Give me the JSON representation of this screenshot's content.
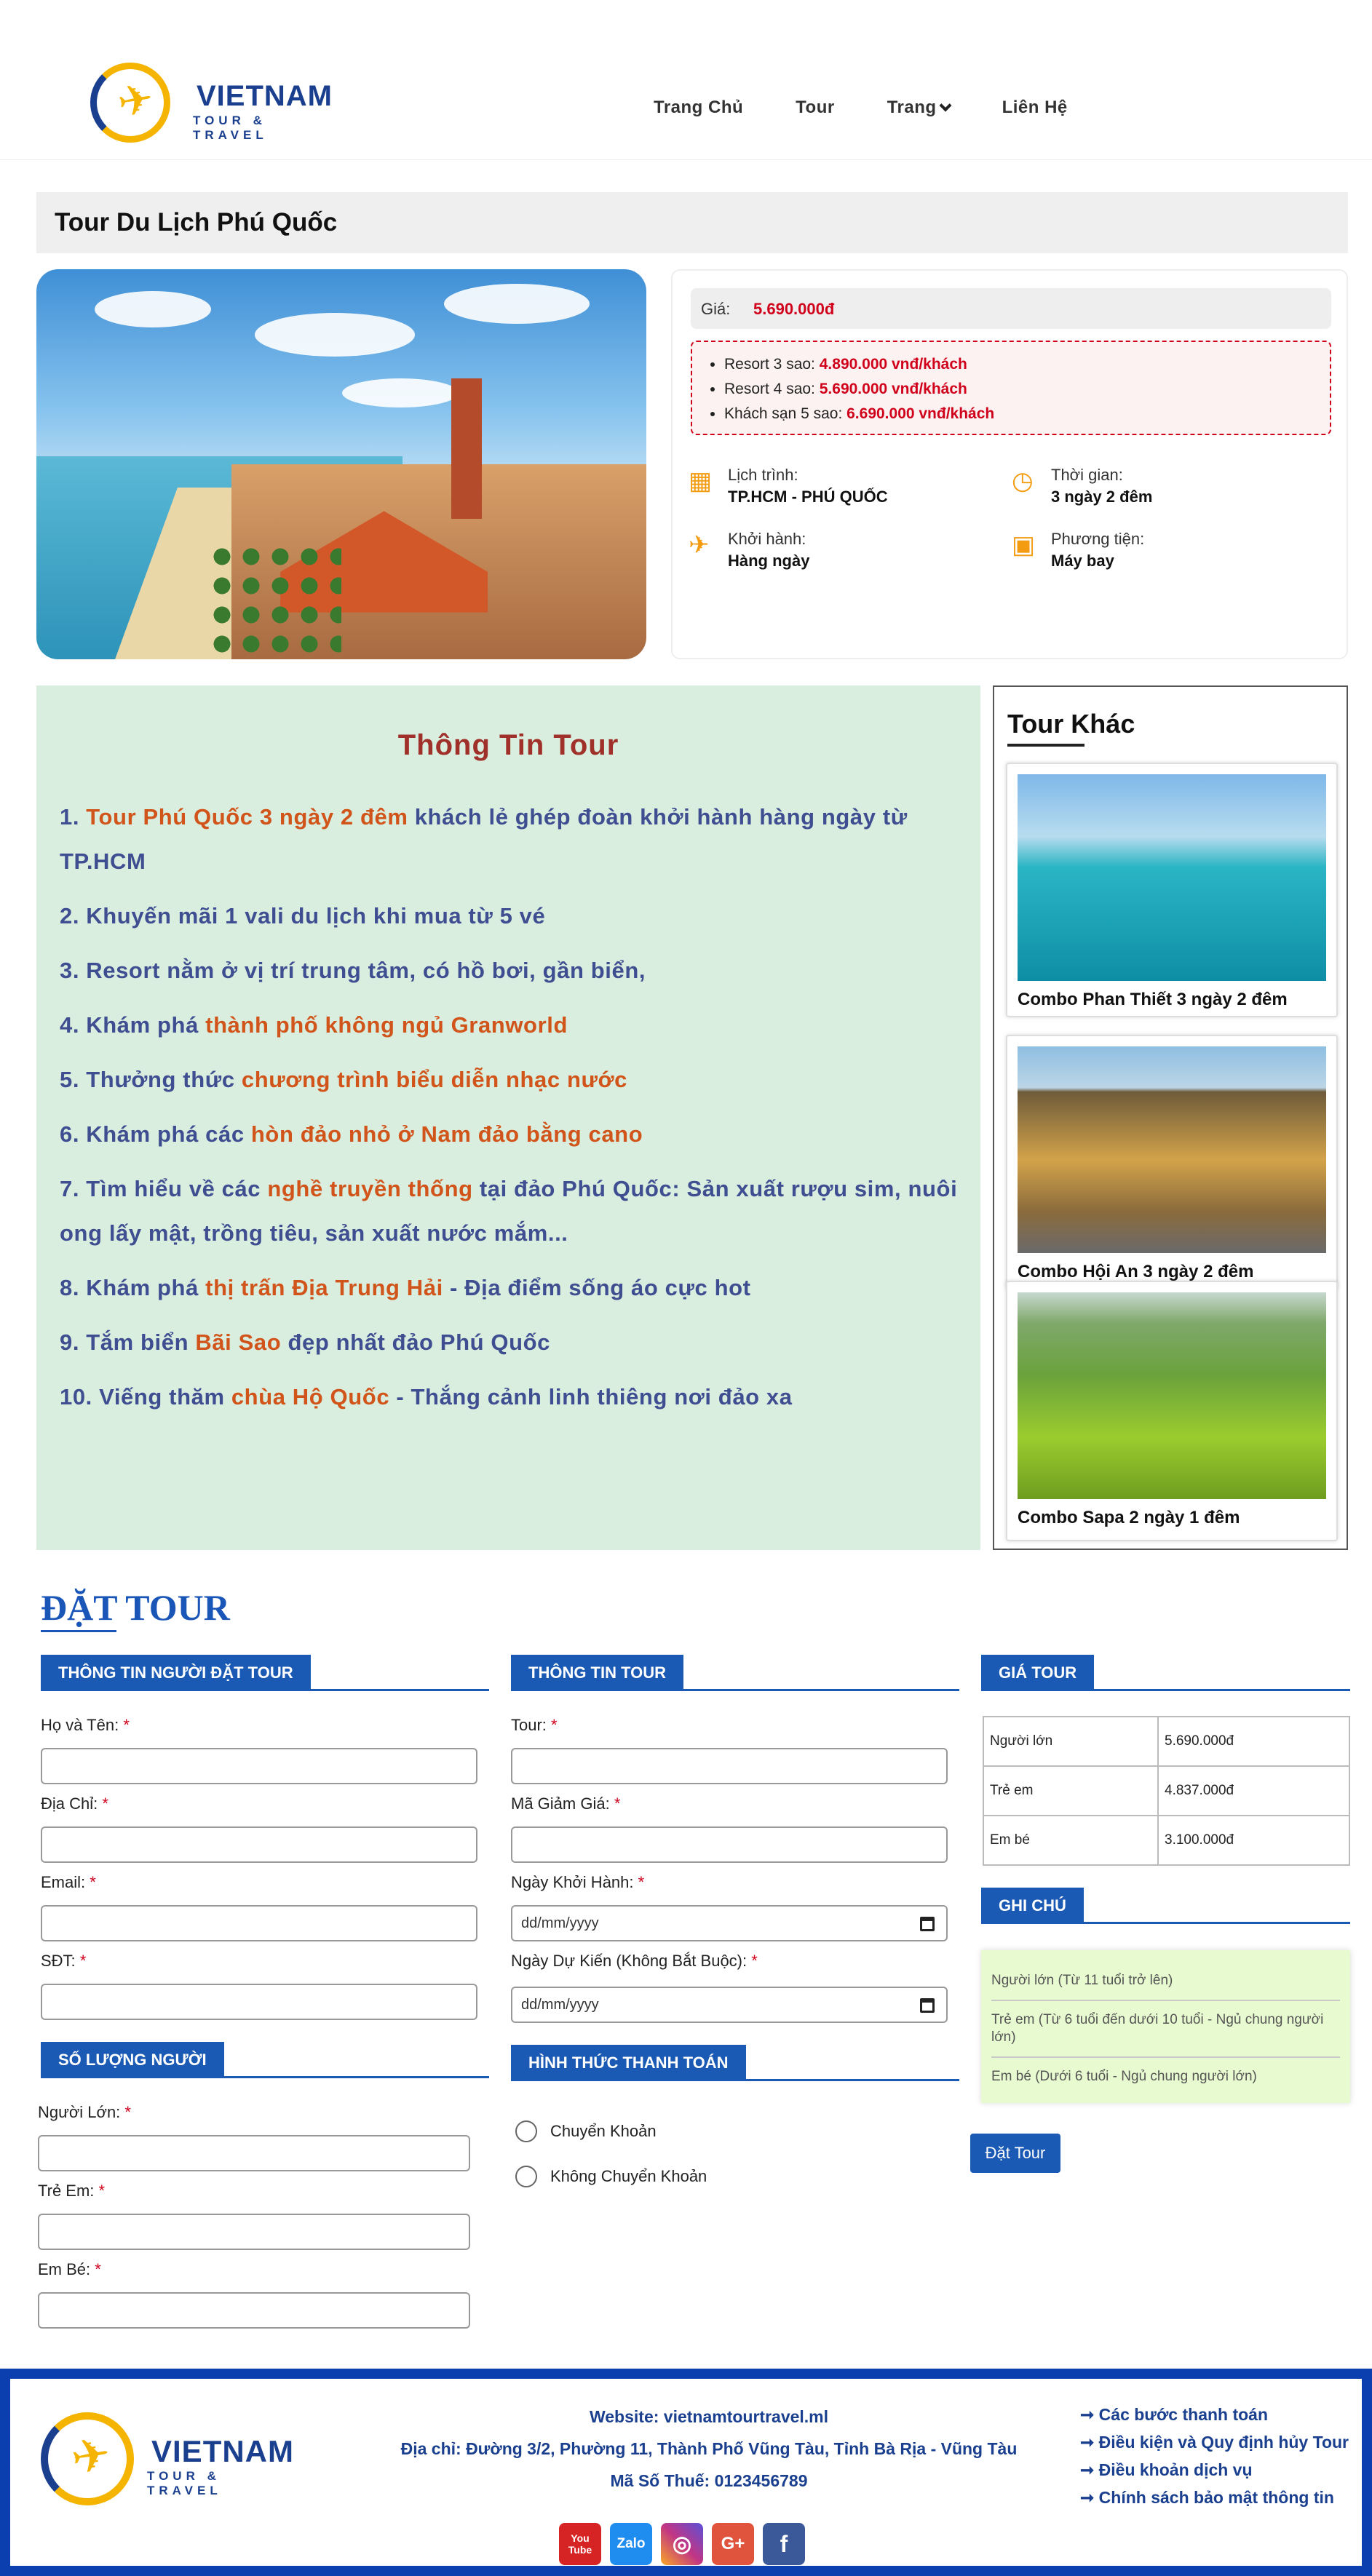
{
  "brand": {
    "name": "VIETNAM",
    "tagline": "TOUR & TRAVEL"
  },
  "nav": [
    {
      "label": "Trang Chủ"
    },
    {
      "label": "Tour"
    },
    {
      "label": "Trang"
    },
    {
      "label": "Liên Hệ"
    }
  ],
  "page_title": "Tour Du Lịch Phú Quốc",
  "price": {
    "label": "Giá:",
    "value": "5.690.000đ"
  },
  "options": [
    {
      "label": "Resort 3 sao:",
      "price": "4.890.000 vnđ/khách"
    },
    {
      "label": "Resort 4 sao:",
      "price": "5.690.000 vnđ/khách"
    },
    {
      "label": "Khách sạn 5 sao:",
      "price": "6.690.000 vnđ/khách"
    }
  ],
  "meta": {
    "schedule": {
      "label": "Lịch trình:",
      "value": "TP.HCM - PHÚ QUỐC",
      "icon": "calendar-icon"
    },
    "duration": {
      "label": "Thời gian:",
      "value": "3 ngày 2 đêm",
      "icon": "clock-icon"
    },
    "departure": {
      "label": "Khởi hành:",
      "value": "Hàng ngày",
      "icon": "plane-icon"
    },
    "transport": {
      "label": "Phương tiện:",
      "value": "Máy bay",
      "icon": "bus-icon"
    }
  },
  "tour_info": {
    "title": "Thông Tin Tour",
    "items": [
      {
        "pre": "1. ",
        "hl": "Tour Phú Quốc 3 ngày 2 đêm",
        "post": " khách lẻ ghép đoàn khởi hành hàng ngày từ TP.HCM"
      },
      {
        "pre": "2. Khuyến mãi 1 vali du lịch khi mua từ 5 vé",
        "hl": "",
        "post": ""
      },
      {
        "pre": "3. Resort nằm ở vị trí trung tâm, có hồ bơi, gần biển,",
        "hl": "",
        "post": ""
      },
      {
        "pre": "4. Khám phá ",
        "hl": "thành phố không ngủ Granworld",
        "post": ""
      },
      {
        "pre": "5. Thưởng thức ",
        "hl": "chương trình biểu diễn nhạc nước",
        "post": ""
      },
      {
        "pre": "6. Khám phá các ",
        "hl": "hòn đảo nhỏ ở Nam đảo bằng cano",
        "post": ""
      },
      {
        "pre": "7. Tìm hiểu về các ",
        "hl": "nghề truyền thống",
        "post": " tại đảo Phú Quốc: Sản xuất rượu sim, nuôi ong lấy mật, trồng tiêu, sản xuất nước mắm..."
      },
      {
        "pre": "8. Khám phá ",
        "hl": "thị trấn Địa Trung Hải",
        "post": " - Địa điểm sống áo cực hot"
      },
      {
        "pre": "9. Tắm biển ",
        "hl": "Bãi Sao",
        "post": " đẹp nhất đảo Phú Quốc"
      },
      {
        "pre": "10. Viếng thăm ",
        "hl": "chùa Hộ Quốc",
        "post": " - Thắng cảnh linh thiêng nơi đảo xa"
      }
    ]
  },
  "other_tours": {
    "title": "Tour Khác",
    "items": [
      {
        "caption": "Combo Phan Thiết 3 ngày 2 đêm"
      },
      {
        "caption": "Combo Hội An 3 ngày 2 đêm"
      },
      {
        "caption": "Combo Sapa 2 ngày 1 đêm"
      }
    ]
  },
  "booking": {
    "title": "ĐẶT TOUR",
    "customer": {
      "heading": "THÔNG TIN NGƯỜI ĐẶT TOUR",
      "name_label": "Họ và Tên:",
      "address_label": "Địa Chỉ:",
      "email_label": "Email:",
      "phone_label": "SĐT:"
    },
    "quantity": {
      "heading": "SỐ LƯỢNG NGƯỜI",
      "adult_label": "Người Lớn:",
      "child_label": "Trẻ Em:",
      "baby_label": "Em Bé:"
    },
    "tour": {
      "heading": "THÔNG TIN TOUR",
      "tour_label": "Tour:",
      "discount_label": "Mã Giảm Giá:",
      "start_label": "Ngày Khởi Hành:",
      "expected_label": "Ngày Dự Kiến (Không Bắt Buộc):",
      "date_placeholder": "dd/mm/yyyy"
    },
    "payment": {
      "heading": "HÌNH THỨC THANH TOÁN",
      "options": [
        "Chuyển Khoản",
        "Không Chuyển Khoản"
      ]
    },
    "price_section": {
      "heading": "GIÁ TOUR",
      "rows": [
        {
          "label": "Người lớn",
          "value": "5.690.000đ"
        },
        {
          "label": "Trẻ em",
          "value": "4.837.000đ"
        },
        {
          "label": "Em bé",
          "value": "3.100.000đ"
        }
      ]
    },
    "notes": {
      "heading": "GHI CHÚ",
      "items": [
        "Người lớn (Từ 11 tuổi trở lên)",
        "Trẻ em (Từ 6 tuổi đến dưới 10 tuổi - Ngủ chung người lớn)",
        "Em bé (Dưới 6 tuổi - Ngủ chung người lớn)"
      ]
    },
    "submit_label": "Đặt Tour",
    "required_mark": "*"
  },
  "footer": {
    "website": "Website: vietnamtourtravel.ml",
    "address": "Địa chỉ: Đường 3/2, Phường 11, Thành Phố Vũng Tàu, Tỉnh Bà Rịa - Vũng Tàu",
    "tax": "Mã Số Thuế: 0123456789",
    "socials": [
      {
        "label": "You Tube",
        "icon": "youtube-icon",
        "color": "#d62323"
      },
      {
        "label": "Zalo",
        "icon": "zalo-icon",
        "color": "#1f8cf0"
      },
      {
        "label": "◎",
        "icon": "instagram-icon",
        "color": "#c13584"
      },
      {
        "label": "G+",
        "icon": "google-plus-icon",
        "color": "#e0533d"
      },
      {
        "label": "f",
        "icon": "facebook-icon",
        "color": "#3b5998"
      }
    ],
    "links": [
      "➞ Các bước thanh toán",
      "➞ Điều kiện và Quy định hủy Tour",
      "➞ Điều khoản dịch vụ",
      "➞ Chính sách bảo mật thông tin"
    ]
  },
  "colors": {
    "accent": "#1a5ab5",
    "price_red": "#d0021b",
    "highlight_orange": "#d1541a",
    "info_bg": "#d9eedf"
  }
}
